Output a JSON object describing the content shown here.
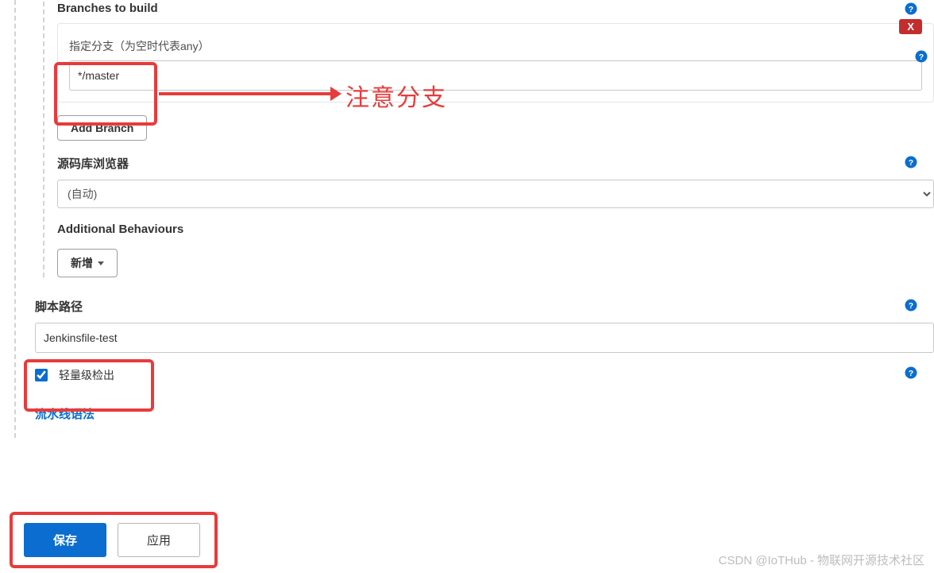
{
  "branches": {
    "title": "Branches to build",
    "specifier_label": "指定分支（为空时代表any）",
    "specifier_value": "*/master",
    "add_button": "Add Branch",
    "delete_label": "X"
  },
  "repo_browser": {
    "label": "源码库浏览器",
    "value": "(自动)"
  },
  "additional_behaviours": {
    "label": "Additional Behaviours",
    "add_button": "新增"
  },
  "script_path": {
    "label": "脚本路径",
    "value": "Jenkinsfile-test"
  },
  "lightweight": {
    "label": "轻量级检出",
    "checked": true
  },
  "pipeline_syntax_link": "流水线语法",
  "buttons": {
    "save": "保存",
    "apply": "应用"
  },
  "annotation_text": "注意分支",
  "watermark": "CSDN @IoTHub - 物联网开源技术社区"
}
